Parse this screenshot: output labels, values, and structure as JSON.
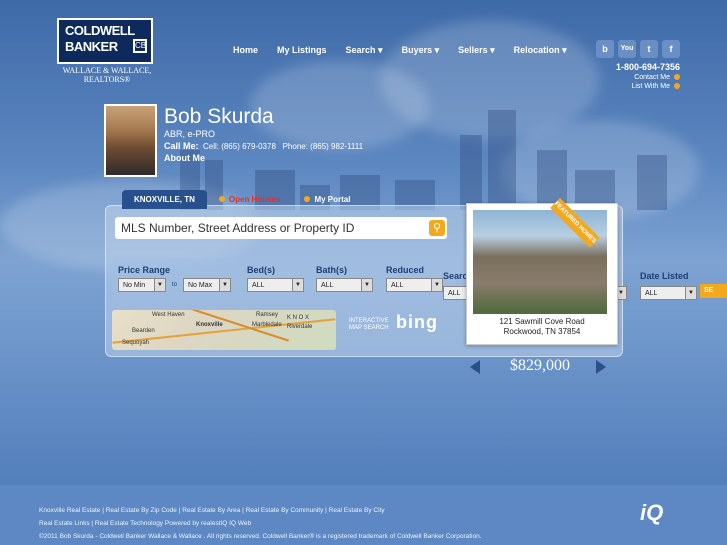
{
  "brand": {
    "line1": "COLDWELL",
    "line2": "BANKER",
    "subtitle": "WALLACE & WALLACE, REALTORS®"
  },
  "nav": [
    "Home",
    "My Listings",
    "Search ▾",
    "Buyers ▾",
    "Sellers ▾",
    "Relocation ▾"
  ],
  "social": [
    {
      "icon": "blog-icon",
      "label": "b",
      "color": "#6b8fc4"
    },
    {
      "icon": "youtube-icon",
      "label": "You",
      "color": "#6b8fc4"
    },
    {
      "icon": "twitter-icon",
      "label": "t",
      "color": "#6b8fc4"
    },
    {
      "icon": "facebook-icon",
      "label": "f",
      "color": "#6b8fc4"
    }
  ],
  "contact": {
    "phone": "1-800-694-7356",
    "contact_me": "Contact Me",
    "list_with_me": "List With Me"
  },
  "agent": {
    "name": "Bob Skurda",
    "credentials": "ABR, e-PRO",
    "call_label": "Call Me:",
    "cell": "Cell: (865) 679-0378",
    "phone": "Phone: (865) 982-1111",
    "about": "About Me"
  },
  "tabs": [
    {
      "label": "KNOXVILLE, TN",
      "active": true
    },
    {
      "label": "Open Houses",
      "active": false
    },
    {
      "label": "My Portal",
      "active": false
    }
  ],
  "search": {
    "placeholder": "MLS Number, Street Address or Property ID"
  },
  "filters": {
    "price_range": "Price Range",
    "price_min": "No Min",
    "to": "to",
    "price_max": "No Max",
    "beds": "Bed(s)",
    "beds_value": "ALL",
    "baths": "Bath(s)",
    "baths_value": "ALL",
    "reduced": "Reduced",
    "reduced_value": "ALL",
    "extra_label": "Searc",
    "extra_value": "ALL",
    "date_listed": "Date Listed",
    "date_value": "ALL",
    "search_button": "SE"
  },
  "map": {
    "label": "INTERACTIVE MAP SEARCH",
    "bing": "bing",
    "places": [
      "West Haven",
      "Knoxville",
      "Ramsey",
      "Marbledale",
      "K N O X",
      "Riverdale",
      "Bearden",
      "Sequoyah"
    ]
  },
  "featured": {
    "ribbon": "FEATURED HOMES",
    "street": "121 Sawmill Cove Road",
    "city": "Rockwood, TN 37854",
    "price": "$829,000"
  },
  "footer": {
    "line1": "Knoxville Real Estate | Real Estate By Zip Code | Real Estate By Area | Real Estate By Community | Real Estate By City",
    "line2": "Real Estate Links | Real Estate Technology Powered by realestIQ IQ Web",
    "line3": "©2011 Bob Skurda - Coldwell Banker Wallace & Wallace . All rights reserved. Coldwell Banker® is a registered trademark of Coldwell Banker Corporation.",
    "iq": "iQ"
  }
}
